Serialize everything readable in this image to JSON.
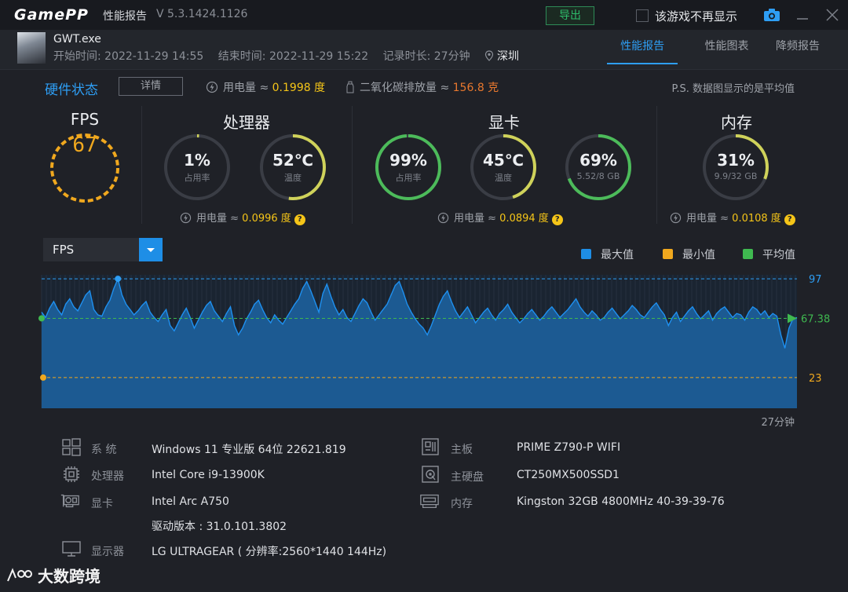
{
  "titlebar": {
    "logo": "GamePP",
    "title": "性能报告",
    "version": "V 5.3.1424.1126",
    "export_label": "导出",
    "dont_show_label": "该游戏不再显示"
  },
  "session": {
    "exe": "GWT.exe",
    "start_label": "开始时间: ",
    "start": "2022-11-29 14:55",
    "end_label": "结束时间: ",
    "end": "2022-11-29 15:22",
    "duration_label": "记录时长: ",
    "duration": "27分钟",
    "city": "深圳"
  },
  "tabs": [
    {
      "label": "性能报告",
      "active": true
    },
    {
      "label": "性能图表",
      "active": false
    },
    {
      "label": "降频报告",
      "active": false
    }
  ],
  "hardware": {
    "title": "硬件状态",
    "details_label": "详情",
    "power_label": "用电量 ≈ ",
    "power_value": "0.1998 度",
    "co2_label": "二氧化碳排放量 ≈ ",
    "co2_value": "156.8 克",
    "note": "P.S. 数据图显示的是平均值"
  },
  "groups": {
    "fps": {
      "title": "FPS",
      "value": "67"
    },
    "cpu": {
      "title": "处理器",
      "usage": {
        "value": "1%",
        "label": "占用率",
        "fraction": 0.01
      },
      "temp": {
        "value": "52℃",
        "label": "温度",
        "fraction": 0.52
      },
      "power_label": "用电量 ≈ ",
      "power_value": "0.0996 度"
    },
    "gpu": {
      "title": "显卡",
      "usage": {
        "value": "99%",
        "label": "占用率",
        "fraction": 0.99
      },
      "temp": {
        "value": "45℃",
        "label": "温度",
        "fraction": 0.45
      },
      "vram": {
        "value": "69%",
        "label": "5.52/8 GB",
        "fraction": 0.69
      },
      "power_label": "用电量 ≈ ",
      "power_value": "0.0894 度"
    },
    "mem": {
      "title": "内存",
      "usage": {
        "value": "31%",
        "label": "9.9/32 GB",
        "fraction": 0.31
      },
      "power_label": "用电量 ≈ ",
      "power_value": "0.0108 度"
    }
  },
  "chart_controls": {
    "metric": "FPS",
    "legend": [
      {
        "label": "最大值",
        "color": "#1e8ee6"
      },
      {
        "label": "最小值",
        "color": "#f0a81e"
      },
      {
        "label": "平均值",
        "color": "#3fb950"
      }
    ]
  },
  "chart_data": {
    "type": "area",
    "ylim": [
      0,
      100
    ],
    "max": 97,
    "min": 23,
    "avg": 67.38,
    "labels": {
      "max": "97",
      "min": "23",
      "avg": "67.38"
    },
    "x_end_label": "27分钟",
    "values": [
      72,
      68,
      75,
      80,
      74,
      70,
      78,
      82,
      76,
      73,
      79,
      85,
      88,
      74,
      70,
      69,
      76,
      81,
      90,
      97,
      85,
      78,
      74,
      70,
      73,
      77,
      80,
      72,
      68,
      65,
      70,
      74,
      62,
      58,
      64,
      70,
      75,
      68,
      60,
      66,
      72,
      77,
      80,
      73,
      69,
      65,
      71,
      76,
      62,
      55,
      60,
      67,
      72,
      78,
      81,
      74,
      68,
      64,
      70,
      66,
      63,
      68,
      73,
      78,
      82,
      90,
      95,
      88,
      80,
      72,
      86,
      93,
      84,
      76,
      70,
      74,
      68,
      65,
      71,
      77,
      82,
      79,
      72,
      66,
      70,
      74,
      78,
      85,
      92,
      95,
      87,
      78,
      72,
      67,
      63,
      60,
      55,
      62,
      70,
      78,
      84,
      88,
      80,
      73,
      68,
      72,
      76,
      70,
      64,
      68,
      72,
      75,
      70,
      66,
      71,
      74,
      78,
      72,
      68,
      64,
      67,
      71,
      74,
      70,
      66,
      69,
      73,
      76,
      72,
      68,
      71,
      74,
      78,
      82,
      76,
      72,
      69,
      73,
      70,
      66,
      68,
      72,
      75,
      71,
      67,
      70,
      73,
      77,
      74,
      70,
      68,
      72,
      76,
      79,
      74,
      70,
      62,
      68,
      72,
      65,
      69,
      73,
      76,
      71,
      67,
      70,
      73,
      66,
      71,
      74,
      76,
      72,
      68,
      71,
      70,
      66,
      72,
      76,
      74,
      70,
      73,
      68,
      71,
      69,
      55,
      45,
      60,
      67,
      68
    ]
  },
  "specs": {
    "os_label": "系  统",
    "os": "Windows 11 专业版 64位 22621.819",
    "cpu_label": "处理器",
    "cpu": "Intel Core i9-13900K",
    "gpu_label": "显卡",
    "gpu": "Intel Arc A750",
    "driver": "驱动版本 : 31.0.101.3802",
    "display_label": "显示器",
    "display": "LG ULTRAGEAR ( 分辨率:2560*1440 144Hz)",
    "board_label": "主板",
    "board": "PRIME Z790-P WIFI",
    "disk_label": "主硬盘",
    "disk": "CT250MX500SSD1",
    "ram_label": "内存",
    "ram": "Kingston 32GB 4800MHz 40-39-39-76"
  },
  "watermark": "大数跨境"
}
